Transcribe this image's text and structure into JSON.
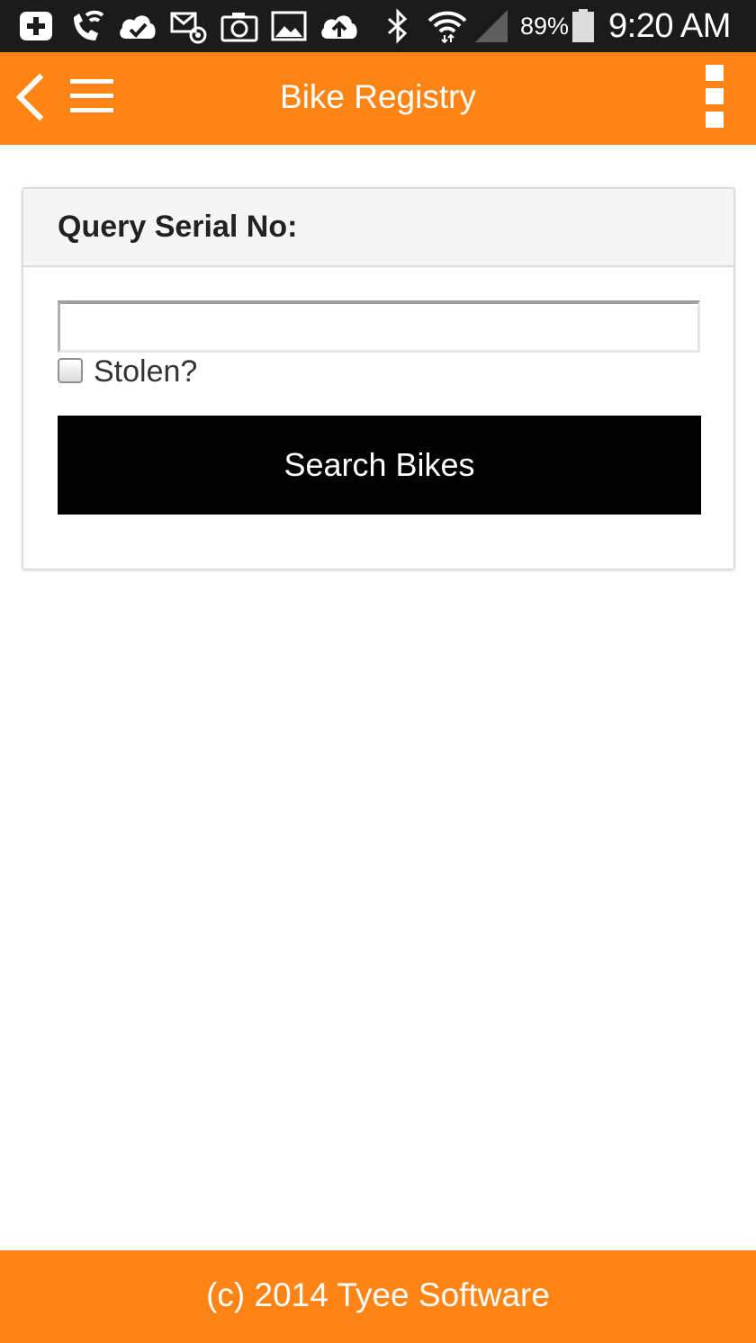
{
  "status_bar": {
    "icons": [
      "add-box-icon",
      "wifi-call-icon",
      "cloud-done-icon",
      "email-sync-icon",
      "camera-icon",
      "image-icon",
      "cloud-upload-icon",
      "bluetooth-icon",
      "wifi-icon",
      "cell-signal-icon",
      "battery-icon"
    ],
    "battery_percent": "89%",
    "time": "9:20 AM"
  },
  "app_bar": {
    "title": "Bike Registry"
  },
  "search_card": {
    "title": "Query Serial No:",
    "serial_value": "",
    "stolen_label": "Stolen?",
    "stolen_checked": false,
    "search_button_label": "Search Bikes"
  },
  "footer": {
    "text": "(c) 2014 Tyee Software"
  },
  "colors": {
    "status_bar_bg": "#1b1b1b",
    "brand_orange": "#fe8416",
    "card_header_bg": "#f5f5f5",
    "button_bg": "#000000",
    "text_dark": "#222222",
    "on_brand_text": "#ffffff"
  }
}
